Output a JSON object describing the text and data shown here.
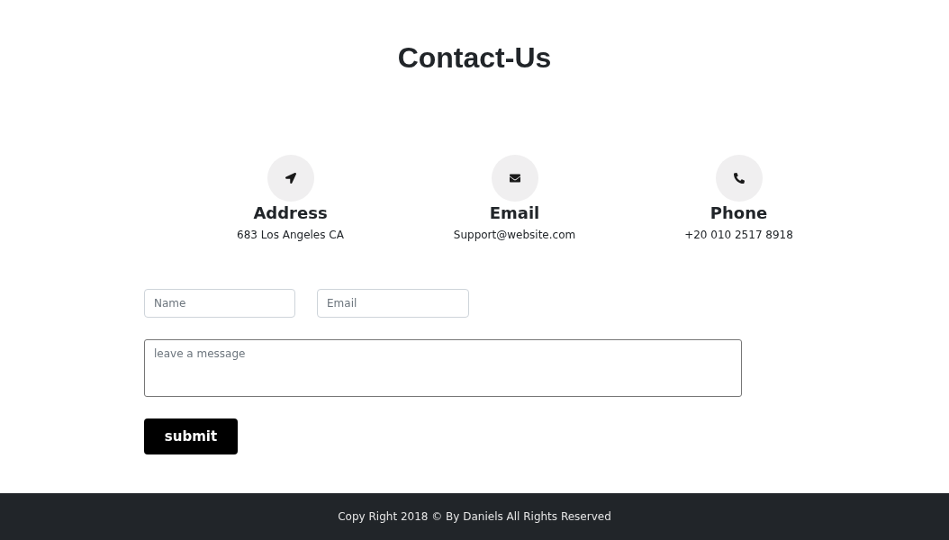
{
  "title": "Contact-Us",
  "info": [
    {
      "kind": "address",
      "heading": "Address",
      "text": "683 Los Angeles CA"
    },
    {
      "kind": "email",
      "heading": "Email",
      "text": "Support@website.com"
    },
    {
      "kind": "phone",
      "heading": "Phone",
      "text": "+20 010 2517 8918"
    }
  ],
  "form": {
    "name": {
      "placeholder": "Name"
    },
    "email": {
      "placeholder": "Email"
    },
    "message": {
      "placeholder": "leave a message"
    },
    "submit": "submit"
  },
  "footer": "Copy Right 2018 © By Daniels All Rights Reserved"
}
